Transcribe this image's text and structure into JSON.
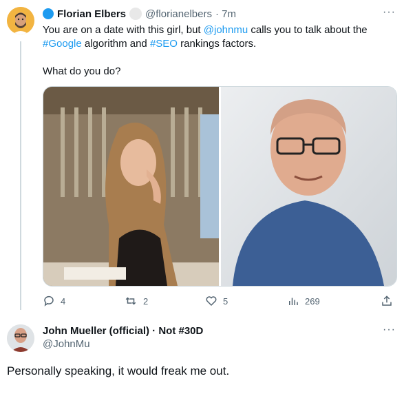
{
  "tweet": {
    "author_name": "Florian Elbers",
    "handle": "@florianelbers",
    "time": "· 7m",
    "text_line1_prefix": "You are on a date with this girl, but ",
    "mention": "@johnmu",
    "text_line1_suffix": " calls you to talk about the",
    "hashtag1": "#Google",
    "text_line2_middle": " algorithm and ",
    "hashtag2": "#SEO",
    "text_line2_suffix": " rankings factors.",
    "question": "What do you do?",
    "actions": {
      "replies": "4",
      "retweets": "2",
      "likes": "5",
      "views": "269"
    }
  },
  "reply": {
    "author_name": "John Mueller (official) · Not #30D",
    "handle": "@JohnMu",
    "text": "Personally speaking, it would freak me out."
  },
  "colors": {
    "link": "#1d9bf0",
    "muted": "#536471",
    "text": "#0f1419",
    "avatar_bg": "#f2b441",
    "verified_blue": "#1d9bf0"
  },
  "icons": [
    "more-options-icon",
    "reply-icon",
    "retweet-icon",
    "like-icon",
    "views-icon",
    "share-icon"
  ]
}
